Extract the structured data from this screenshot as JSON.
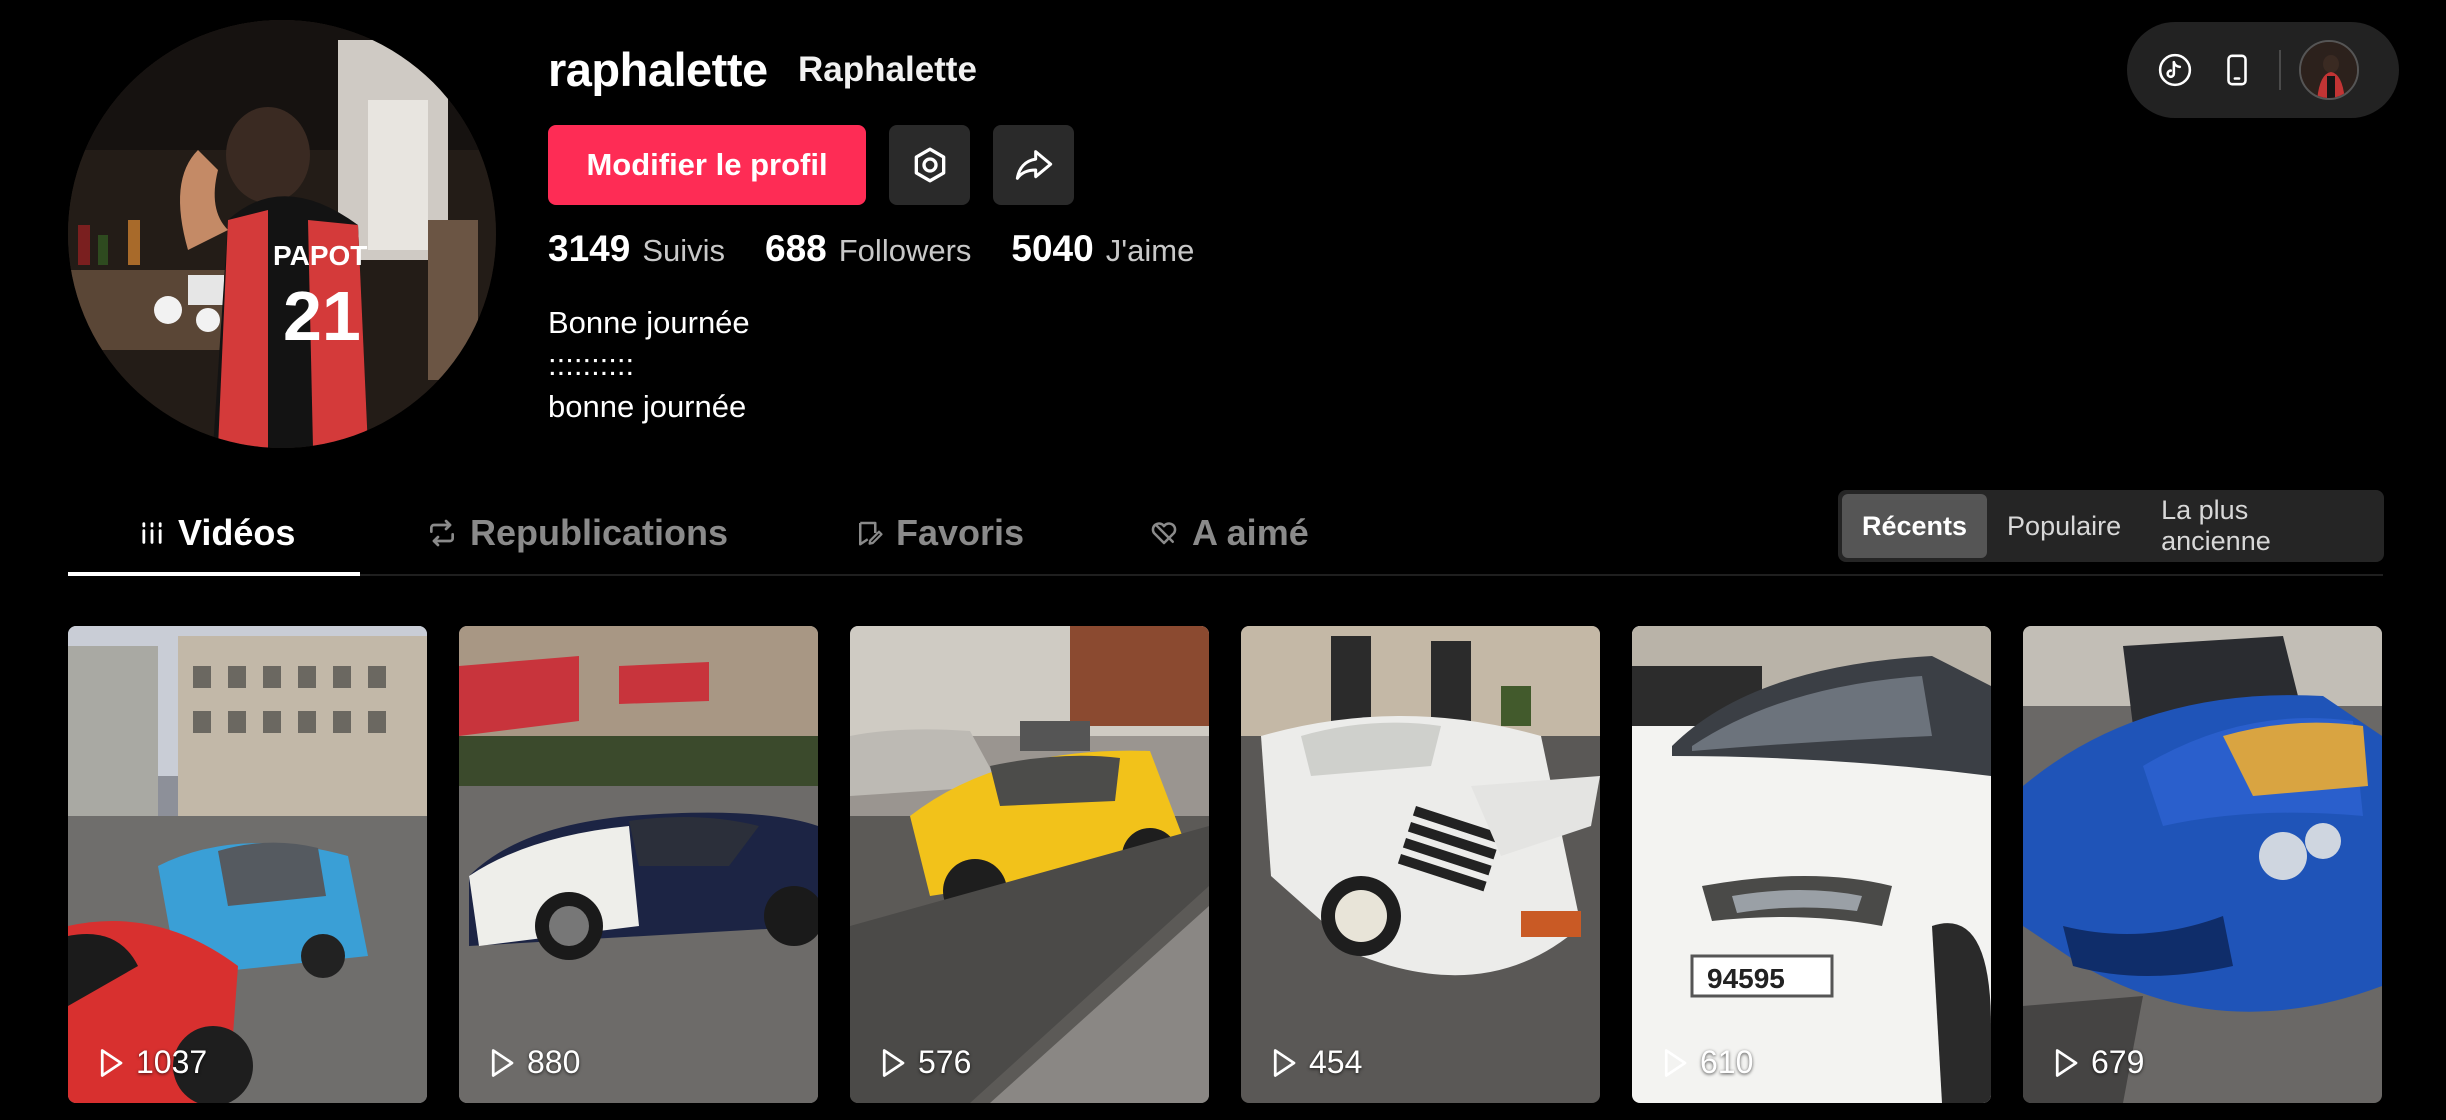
{
  "profile": {
    "username": "raphalette",
    "display_name": "Raphalette",
    "edit_label": "Modifier le profil",
    "stats": [
      {
        "value": "3149",
        "label": "Suivis"
      },
      {
        "value": "688",
        "label": "Followers"
      },
      {
        "value": "5040",
        "label": "J'aime"
      }
    ],
    "bio": [
      "Bonne journée",
      "::::::::::",
      "bonne journée"
    ]
  },
  "top_pill": {
    "icons": [
      "tiktok-icon",
      "phone-icon"
    ]
  },
  "tabs": [
    {
      "label": "Vidéos",
      "icon": "grid-icon",
      "active": true
    },
    {
      "label": "Republications",
      "icon": "repost-icon",
      "active": false
    },
    {
      "label": "Favoris",
      "icon": "bookmark-icon",
      "active": false
    },
    {
      "label": "A aimé",
      "icon": "heart-icon",
      "active": false
    }
  ],
  "sort": [
    "Récents",
    "Populaire",
    "La plus ancienne"
  ],
  "videos": [
    {
      "views": "1037"
    },
    {
      "views": "880"
    },
    {
      "views": "576"
    },
    {
      "views": "454"
    },
    {
      "views": "610"
    },
    {
      "views": "679"
    }
  ],
  "colors": {
    "accent": "#fe2c55",
    "background": "#000000",
    "button_dark": "#2a2a2a"
  }
}
